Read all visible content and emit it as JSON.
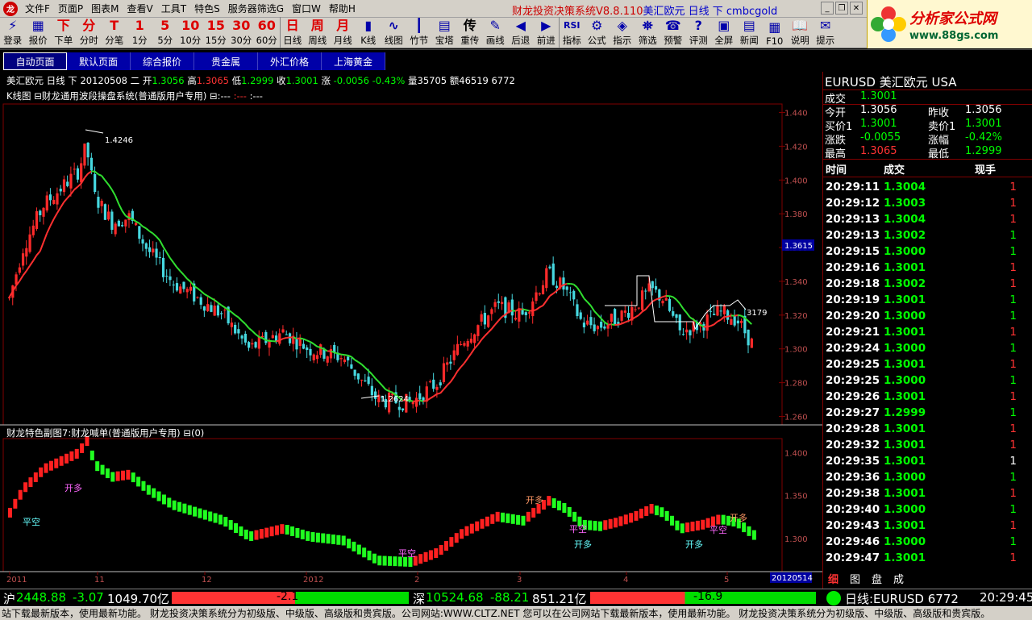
{
  "menu": {
    "items": [
      "文件F",
      "页面P",
      "图表M",
      "查看V",
      "工具T",
      "特色S",
      "服务器筛选G",
      "窗口W",
      "帮助H"
    ],
    "app_title_red": "财龙投资决策系统V8.8.110",
    "app_title_blue": "美汇欧元 日线 下 cmbcgold"
  },
  "brand": {
    "line1": "分析家公式网",
    "line2": "www.88gs.com"
  },
  "toolbar": [
    {
      "icon": "login-icon",
      "glyph": "⚡",
      "label": "登录"
    },
    {
      "icon": "quote-icon",
      "glyph": "▦",
      "label": "报价"
    },
    {
      "icon": "order-icon",
      "glyph": "下",
      "label": "下单"
    },
    {
      "icon": "minute-icon",
      "glyph": "分",
      "label": "分时"
    },
    {
      "icon": "tick-icon",
      "glyph": "T",
      "label": "分笔"
    },
    {
      "icon": "m1-icon",
      "glyph": "1",
      "label": "1分"
    },
    {
      "icon": "m5-icon",
      "glyph": "5",
      "label": "5分"
    },
    {
      "icon": "m10-icon",
      "glyph": "10",
      "label": "10分"
    },
    {
      "icon": "m15-icon",
      "glyph": "15",
      "label": "15分"
    },
    {
      "icon": "m30-icon",
      "glyph": "30",
      "label": "30分"
    },
    {
      "icon": "m60-icon",
      "glyph": "60",
      "label": "60分"
    },
    {
      "icon": "day-icon",
      "glyph": "日",
      "label": "日线"
    },
    {
      "icon": "week-icon",
      "glyph": "周",
      "label": "周线"
    },
    {
      "icon": "month-icon",
      "glyph": "月",
      "label": "月线"
    },
    {
      "icon": "kline-icon",
      "glyph": "▮",
      "label": "K线"
    },
    {
      "icon": "line-chart-icon",
      "glyph": "∿",
      "label": "线图"
    },
    {
      "icon": "bamboo-icon",
      "glyph": "┃",
      "label": "竹节"
    },
    {
      "icon": "tower-icon",
      "glyph": "▤",
      "label": "宝塔"
    },
    {
      "icon": "reprint-icon",
      "glyph": "传",
      "label": "重传"
    },
    {
      "icon": "draw-line-icon",
      "glyph": "✎",
      "label": "画线"
    },
    {
      "icon": "back-icon",
      "glyph": "◀",
      "label": "后退"
    },
    {
      "icon": "forward-icon",
      "glyph": "▶",
      "label": "前进"
    },
    {
      "icon": "indicator-icon",
      "glyph": "RSI",
      "label": "指标"
    },
    {
      "icon": "formula-icon",
      "glyph": "⚙",
      "label": "公式"
    },
    {
      "icon": "index-icon",
      "glyph": "◈",
      "label": "指示"
    },
    {
      "icon": "filter-icon",
      "glyph": "⛯",
      "label": "筛选"
    },
    {
      "icon": "alert-icon",
      "glyph": "☎",
      "label": "预警"
    },
    {
      "icon": "evaluate-icon",
      "glyph": "?",
      "label": "评测"
    },
    {
      "icon": "fullscreen-icon",
      "glyph": "▣",
      "label": "全屏"
    },
    {
      "icon": "news-icon",
      "glyph": "▤",
      "label": "新闻"
    },
    {
      "icon": "f10-icon",
      "glyph": "▦",
      "label": "F10"
    },
    {
      "icon": "explain-icon",
      "glyph": "📖",
      "label": "说明"
    },
    {
      "icon": "hint-icon",
      "glyph": "✉",
      "label": "提示"
    }
  ],
  "tabs": [
    "自动页面",
    "默认页面",
    "综合报价",
    "贵金属",
    "外汇价格",
    "上海黄金"
  ],
  "chart": {
    "info": {
      "name": "美汇欧元 日线 下",
      "date": "20120508 二",
      "open_label": "开",
      "open": "1.3056",
      "high_label": "高",
      "high": "1.3065",
      "low_label": "低",
      "low": "1.2999",
      "close_label": "收",
      "close": "1.3001",
      "change_label": "涨",
      "change": "-0.0056",
      "change_pct": "-0.43%",
      "volume_label": "量",
      "volume": "35705",
      "amount_label": "额",
      "amount": "46519 6772"
    },
    "indicator_line": "K线图 ⊟财龙通用波段操盘系统(普通版用户专用) ⊟:---",
    "indicator_line_red": ":---",
    "indicator_line_tail": ":---",
    "sub_line": "财龙特色副图7:财龙喊单(普通版用户专用) ⊟(0)",
    "main_axis": [
      "1.440",
      "1.420",
      "1.400",
      "1.380",
      "1.360",
      "1.340",
      "1.320",
      "1.300",
      "1.280",
      "1.260"
    ],
    "sub_axis": [
      "1.400",
      "1.350",
      "1.300"
    ],
    "current_price_tag": "1.3615",
    "annotations": {
      "high": "1.4246",
      "low": "1.2624",
      "last": "3179"
    },
    "signals": [
      "开多",
      "平空",
      "开多",
      "平空",
      "开多",
      "平空",
      "开多"
    ],
    "date_axis": [
      "2011",
      "11",
      "12",
      "2012",
      "2",
      "3",
      "4",
      "5"
    ],
    "date_end_tag": "20120514",
    "colors": {
      "up": "#ff2a2a",
      "down": "#46d8e0",
      "ma_red": "#ff3030",
      "ma_green": "#30e030",
      "grid": "#800000"
    }
  },
  "chart_data": {
    "type": "candlestick",
    "title": "美汇欧元 日线",
    "ylim": [
      1.255,
      1.445
    ],
    "ohlc_description": "EURUSD daily candles from late 2011 to 2012-05-14",
    "key_points": [
      {
        "label": "high",
        "value": 1.4246
      },
      {
        "label": "low",
        "value": 1.2624
      },
      {
        "label": "last close",
        "value": 1.3001
      }
    ]
  },
  "quote": {
    "title": "EURUSD  美汇欧元  USA",
    "rows": [
      {
        "l1": "成交",
        "v1": "1.3001"
      },
      {
        "l1": "今开",
        "v1": "1.3056",
        "l2": "昨收",
        "v2": "1.3056"
      },
      {
        "l1": "买价1",
        "v1": "1.3001",
        "l2": "卖价1",
        "v2": "1.3001"
      },
      {
        "l1": "涨跌",
        "v1": "-0.0055",
        "l2": "涨幅",
        "v2": "-0.42%"
      },
      {
        "l1": "最高",
        "v1": "1.3065",
        "l2": "最低",
        "v2": "1.2999"
      }
    ],
    "tick_header": {
      "time": "时间",
      "price": "成交",
      "vol": "现手"
    },
    "ticks": [
      {
        "time": "20:29:11",
        "price": "1.3004",
        "vol": "1",
        "c": "r"
      },
      {
        "time": "20:29:12",
        "price": "1.3003",
        "vol": "1",
        "c": "r"
      },
      {
        "time": "20:29:13",
        "price": "1.3004",
        "vol": "1",
        "c": "r"
      },
      {
        "time": "20:29:13",
        "price": "1.3002",
        "vol": "1",
        "c": "g"
      },
      {
        "time": "20:29:15",
        "price": "1.3000",
        "vol": "1",
        "c": "g"
      },
      {
        "time": "20:29:16",
        "price": "1.3001",
        "vol": "1",
        "c": "r"
      },
      {
        "time": "20:29:18",
        "price": "1.3002",
        "vol": "1",
        "c": "r"
      },
      {
        "time": "20:29:19",
        "price": "1.3001",
        "vol": "1",
        "c": "g"
      },
      {
        "time": "20:29:20",
        "price": "1.3000",
        "vol": "1",
        "c": "g"
      },
      {
        "time": "20:29:21",
        "price": "1.3001",
        "vol": "1",
        "c": "r"
      },
      {
        "time": "20:29:24",
        "price": "1.3000",
        "vol": "1",
        "c": "g"
      },
      {
        "time": "20:29:25",
        "price": "1.3001",
        "vol": "1",
        "c": "r"
      },
      {
        "time": "20:29:25",
        "price": "1.3000",
        "vol": "1",
        "c": "g"
      },
      {
        "time": "20:29:26",
        "price": "1.3001",
        "vol": "1",
        "c": "r"
      },
      {
        "time": "20:29:27",
        "price": "1.2999",
        "vol": "1",
        "c": "g"
      },
      {
        "time": "20:29:28",
        "price": "1.3001",
        "vol": "1",
        "c": "r"
      },
      {
        "time": "20:29:32",
        "price": "1.3001",
        "vol": "1",
        "c": "r"
      },
      {
        "time": "20:29:35",
        "price": "1.3001",
        "vol": "1",
        "c": "w"
      },
      {
        "time": "20:29:36",
        "price": "1.3000",
        "vol": "1",
        "c": "g"
      },
      {
        "time": "20:29:38",
        "price": "1.3001",
        "vol": "1",
        "c": "r"
      },
      {
        "time": "20:29:40",
        "price": "1.3000",
        "vol": "1",
        "c": "g"
      },
      {
        "time": "20:29:43",
        "price": "1.3001",
        "vol": "1",
        "c": "r"
      },
      {
        "time": "20:29:46",
        "price": "1.3000",
        "vol": "1",
        "c": "g"
      },
      {
        "time": "20:29:47",
        "price": "1.3001",
        "vol": "1",
        "c": "r"
      }
    ],
    "bottom_tabs": [
      "细",
      "图",
      "盘",
      "成"
    ]
  },
  "status": {
    "sh_label": "沪",
    "sh_index": "2448.88",
    "sh_change": "-3.07",
    "sh_amount": "1049.70亿",
    "sh_bar_value": "-2.1",
    "sz_label": "深",
    "sz_index": "10524.68",
    "sz_change": "-88.21",
    "sz_amount": "851.21亿",
    "sz_bar_value": "-16.9",
    "ticker": "日线:EURUSD 6772",
    "clock": "20:29:45"
  },
  "footer": "站下载最新版本，使用最新功能。    财龙投资决策系统分为初级版、中级版、高级版和贵宾版。公司网站:WWW.CLTZ.NET    您可以在公司网站下载最新版本，使用最新功能。    财龙投资决策系统分为初级版、中级版、高级版和贵宾版。"
}
